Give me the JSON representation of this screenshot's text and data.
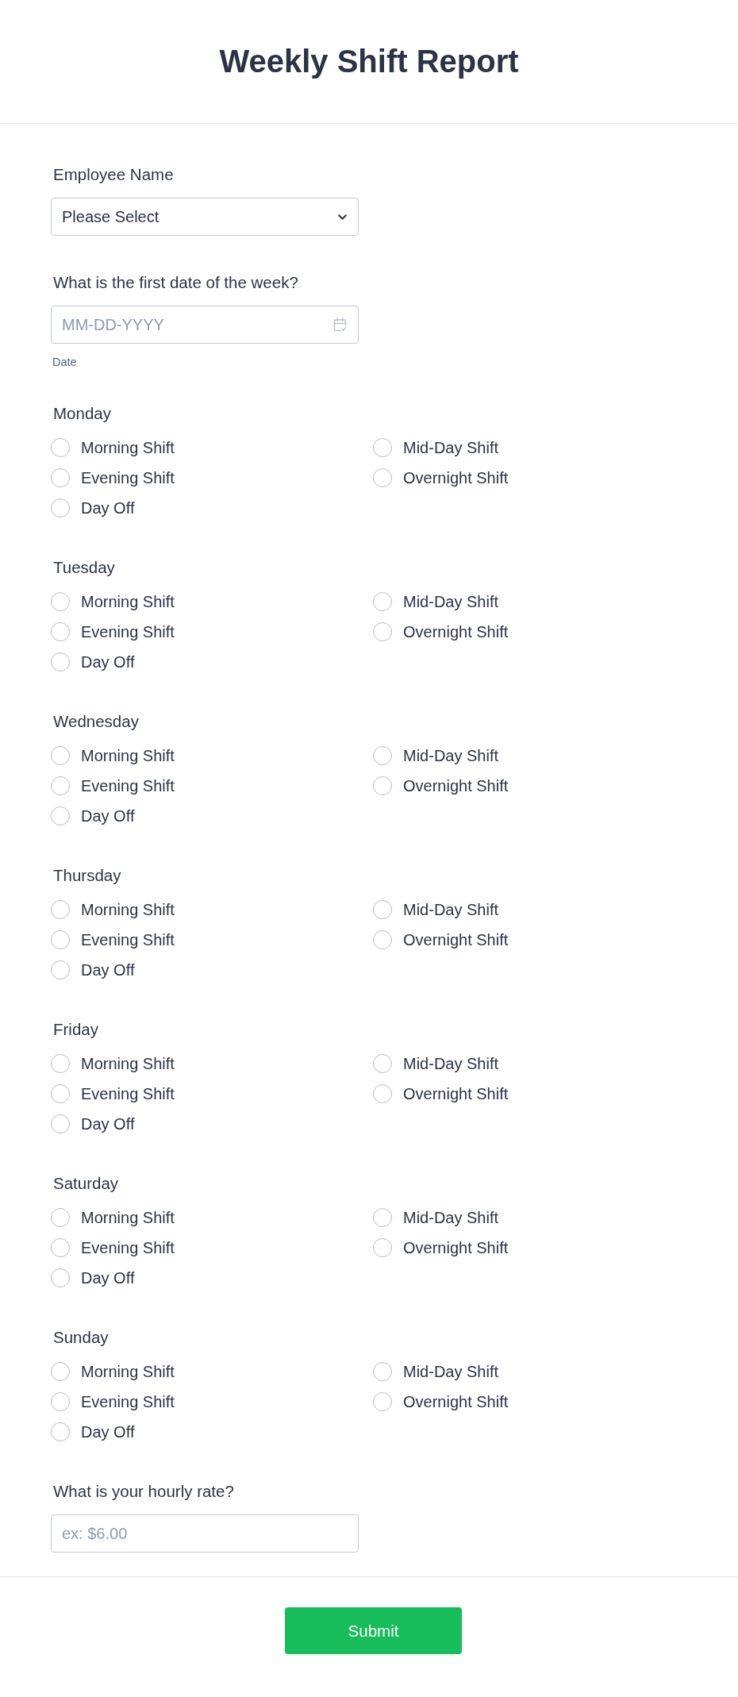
{
  "header": {
    "title": "Weekly Shift Report"
  },
  "employee_name": {
    "label": "Employee Name",
    "value": "Please Select"
  },
  "first_date": {
    "label": "What is the first date of the week?",
    "placeholder": "MM-DD-YYYY",
    "sublabel": "Date"
  },
  "days": [
    {
      "label": "Monday",
      "options": [
        {
          "label": "Morning Shift",
          "selected": false
        },
        {
          "label": "Mid-Day Shift",
          "selected": false
        },
        {
          "label": "Evening Shift",
          "selected": false
        },
        {
          "label": "Overnight Shift",
          "selected": false
        },
        {
          "label": "Day Off",
          "selected": false
        }
      ]
    },
    {
      "label": "Tuesday",
      "options": [
        {
          "label": "Morning Shift",
          "selected": false
        },
        {
          "label": "Mid-Day Shift",
          "selected": false
        },
        {
          "label": "Evening Shift",
          "selected": false
        },
        {
          "label": "Overnight Shift",
          "selected": false
        },
        {
          "label": "Day Off",
          "selected": false
        }
      ]
    },
    {
      "label": "Wednesday",
      "options": [
        {
          "label": "Morning Shift",
          "selected": false
        },
        {
          "label": "Mid-Day Shift",
          "selected": false
        },
        {
          "label": "Evening Shift",
          "selected": false
        },
        {
          "label": "Overnight Shift",
          "selected": false
        },
        {
          "label": "Day Off",
          "selected": false
        }
      ]
    },
    {
      "label": "Thursday",
      "options": [
        {
          "label": "Morning Shift",
          "selected": false
        },
        {
          "label": "Mid-Day Shift",
          "selected": false
        },
        {
          "label": "Evening Shift",
          "selected": false
        },
        {
          "label": "Overnight Shift",
          "selected": false
        },
        {
          "label": "Day Off",
          "selected": false
        }
      ]
    },
    {
      "label": "Friday",
      "options": [
        {
          "label": "Morning Shift",
          "selected": false
        },
        {
          "label": "Mid-Day Shift",
          "selected": false
        },
        {
          "label": "Evening Shift",
          "selected": false
        },
        {
          "label": "Overnight Shift",
          "selected": false
        },
        {
          "label": "Day Off",
          "selected": false
        }
      ]
    },
    {
      "label": "Saturday",
      "options": [
        {
          "label": "Morning Shift",
          "selected": false
        },
        {
          "label": "Mid-Day Shift",
          "selected": false
        },
        {
          "label": "Evening Shift",
          "selected": false
        },
        {
          "label": "Overnight Shift",
          "selected": false
        },
        {
          "label": "Day Off",
          "selected": false
        }
      ]
    },
    {
      "label": "Sunday",
      "options": [
        {
          "label": "Morning Shift",
          "selected": false
        },
        {
          "label": "Mid-Day Shift",
          "selected": false
        },
        {
          "label": "Evening Shift",
          "selected": false
        },
        {
          "label": "Overnight Shift",
          "selected": false
        },
        {
          "label": "Day Off",
          "selected": false
        }
      ]
    }
  ],
  "hourly_rate": {
    "label": "What is your hourly rate?",
    "placeholder": "ex: $6.00"
  },
  "submit_button": {
    "label": "Submit"
  }
}
